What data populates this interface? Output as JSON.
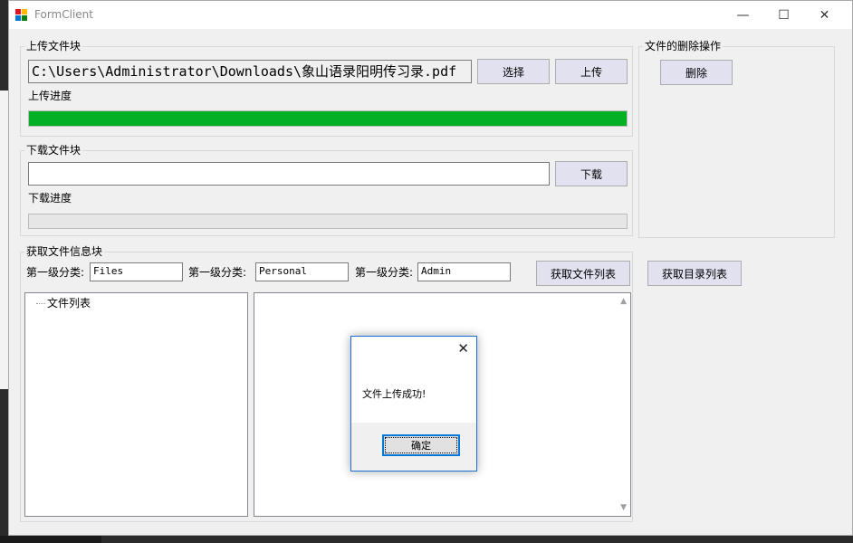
{
  "window": {
    "title": "FormClient",
    "minimize_glyph": "—",
    "maximize_glyph": "☐",
    "close_glyph": "✕"
  },
  "upload": {
    "group_label": "上传文件块",
    "path_value": "C:\\Users\\Administrator\\Downloads\\象山语录阳明传习录.pdf",
    "select_button": "选择",
    "upload_button": "上传",
    "progress_label": "上传进度",
    "progress": 1.0
  },
  "delete": {
    "group_label": "文件的删除操作",
    "delete_button": "删除"
  },
  "download": {
    "group_label": "下载文件块",
    "path_value": "",
    "download_button": "下载",
    "progress_label": "下载进度",
    "progress": 0.0
  },
  "info": {
    "group_label": "获取文件信息块",
    "category1_label": "第一级分类:",
    "category1_value": "Files",
    "category2_label": "第一级分类:",
    "category2_value": "Personal",
    "category3_label": "第一级分类:",
    "category3_value": "Admin",
    "get_files_button": "获取文件列表",
    "get_dirs_button": "获取目录列表",
    "tree_root": "文件列表"
  },
  "dialog": {
    "message": "文件上传成功!",
    "ok_button": "确定",
    "close_glyph": "✕"
  },
  "colors": {
    "progress_fill": "#06b025",
    "dialog_border": "#1c6fd6",
    "button_face": "#e1e1f0"
  }
}
